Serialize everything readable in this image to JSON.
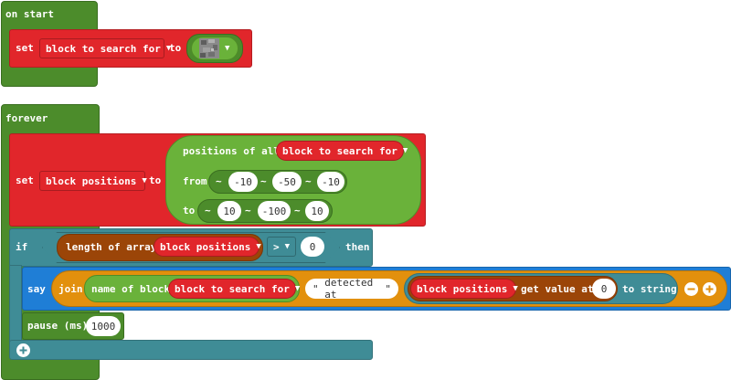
{
  "on_start": {
    "label": "on start",
    "set_label": "set",
    "variable": "block to search for",
    "to_label": "to"
  },
  "forever": {
    "label": "forever",
    "set_label": "set",
    "variable": "block positions",
    "to_label": "to",
    "positions": {
      "label": "positions of all",
      "variable": "block to search for",
      "from_label": "from",
      "to_label": "to",
      "tilde": "~",
      "from": [
        "-10",
        "-50",
        "-10"
      ],
      "to": [
        "10",
        "-100",
        "10"
      ]
    },
    "if_block": {
      "if_label": "if",
      "length_label": "length of array",
      "variable": "block positions",
      "operator": ">",
      "compare_value": "0",
      "then_label": "then"
    },
    "say_block": {
      "say_label": "say",
      "join_label": "join",
      "name_label": "name of block",
      "name_var": "block to search for",
      "string_value": "detected at",
      "array_var": "block positions",
      "get_label": "get value at",
      "index": "0",
      "to_string_label": "to string"
    },
    "pause_block": {
      "label": "pause (ms)",
      "value": "1000"
    }
  }
}
